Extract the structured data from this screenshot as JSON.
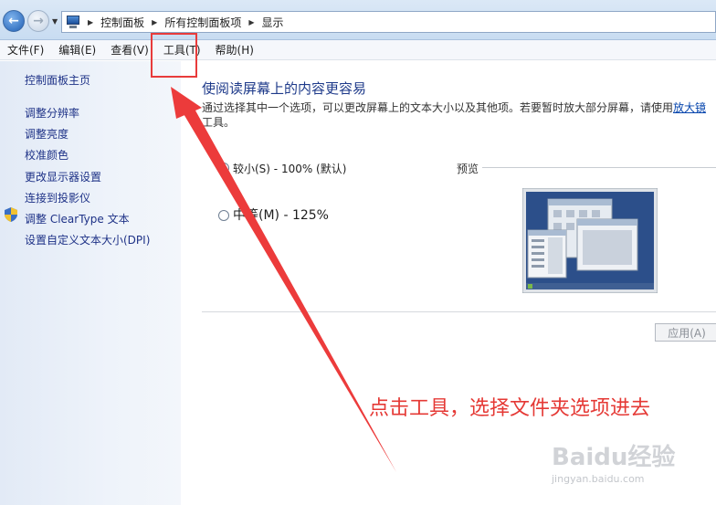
{
  "breadcrumb": [
    "控制面板",
    "所有控制面板项",
    "显示"
  ],
  "menu": [
    "文件(F)",
    "编辑(E)",
    "查看(V)",
    "工具(T)",
    "帮助(H)"
  ],
  "sidebar": {
    "home": "控制面板主页",
    "links": [
      "调整分辨率",
      "调整亮度",
      "校准颜色",
      "更改显示器设置",
      "连接到投影仪",
      "调整 ClearType 文本",
      "设置自定义文本大小(DPI)"
    ]
  },
  "main": {
    "title": "使阅读屏幕上的内容更容易",
    "description": "通过选择其中一个选项，可以更改屏幕上的文本大小以及其他项。若要暂时放大部分屏幕，请使用",
    "magnifier_link": "放大镜",
    "description_tail": "工具。",
    "options": [
      {
        "label": "较小(S) - 100% (默认)",
        "selected": true
      },
      {
        "label": "中等(M) - 125%",
        "selected": false
      }
    ],
    "preview_label": "预览",
    "apply_button": "应用(A)"
  },
  "annotation": {
    "text": "点击工具，选择文件夹选项进去",
    "color": "#e53935"
  },
  "watermark": {
    "brand": "Baidu经验",
    "url": "jingyan.baidu.com"
  }
}
